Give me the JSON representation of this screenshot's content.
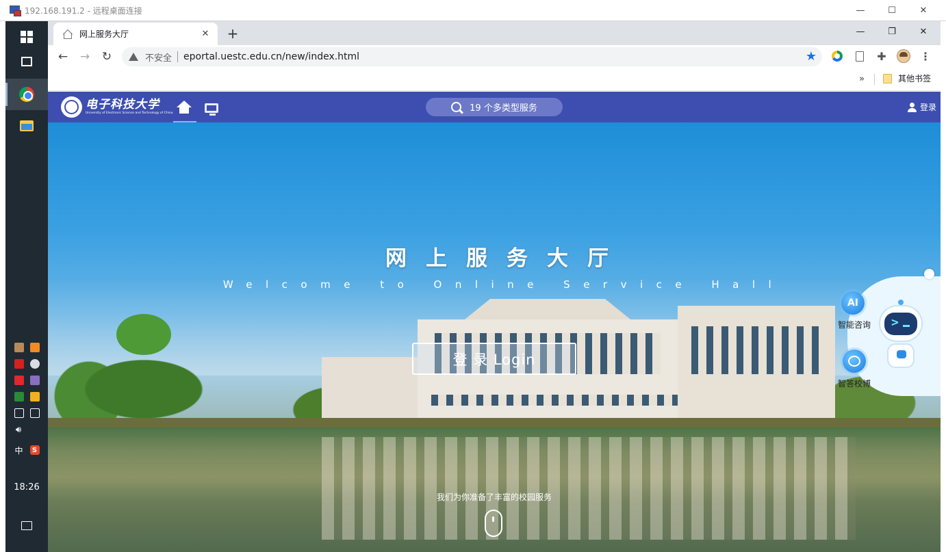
{
  "rdp": {
    "title": "192.168.191.2 - 远程桌面连接",
    "minimize": "—",
    "maximize": "☐",
    "close": "✕"
  },
  "taskbar": {
    "clock": "18:26",
    "ime": "中",
    "apps": [
      "start-button",
      "task-view",
      "chrome",
      "file-explorer"
    ]
  },
  "browser": {
    "tab": {
      "title": "网上服务大厅",
      "close": "✕"
    },
    "new_tab": "+",
    "window": {
      "minimize": "—",
      "maximize": "❐",
      "close": "✕"
    },
    "nav": {
      "back": "←",
      "forward": "→",
      "reload": "↻"
    },
    "omnibox": {
      "security": "不安全",
      "url": "eportal.uestc.edu.cn/new/index.html",
      "star": "★"
    },
    "menu": "⋮",
    "bookmarks": {
      "overflow": "»",
      "folder": "其他书签"
    }
  },
  "site": {
    "logo_cn": "电子科技大学",
    "logo_en": "University of Electronic Science and Technology of China",
    "search_label": "19 个多类型服务",
    "login": "登录",
    "hero_title": "网上服务大厅",
    "hero_subtitle": "Welcome to Online Service Hall",
    "login_button": "登 录  Login",
    "tagline": "我们为你准备了丰富的校园服务",
    "assistant": {
      "ai_badge": "AI",
      "ai_label": "智能咨询",
      "chat_label": "智答校博"
    }
  },
  "colors": {
    "site_nav": "#3d4eb0",
    "taskbar": "#202a33",
    "accent": "#1a73e8"
  }
}
